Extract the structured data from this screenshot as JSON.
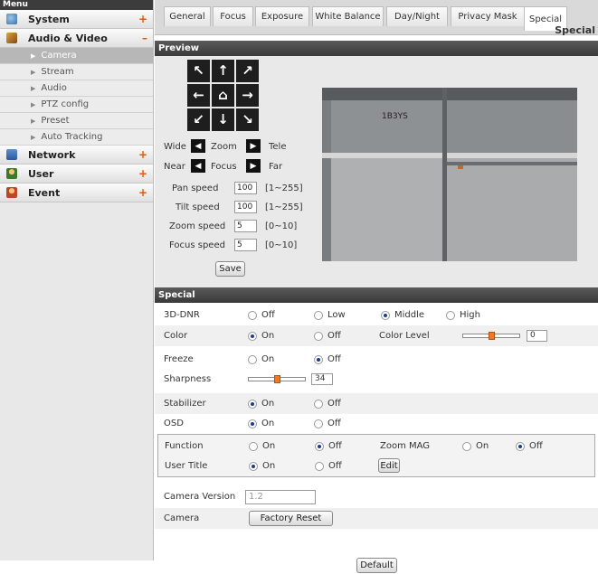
{
  "sidebar": {
    "menu_title": "Menu",
    "sections": [
      {
        "label": "System",
        "toggle": "+",
        "icon": "system-icon"
      },
      {
        "label": "Audio & Video",
        "toggle": "–",
        "icon": "audio-video-icon"
      },
      {
        "label": "Network",
        "toggle": "+",
        "icon": "network-icon"
      },
      {
        "label": "User",
        "toggle": "+",
        "icon": "user-icon"
      },
      {
        "label": "Event",
        "toggle": "+",
        "icon": "event-icon"
      }
    ],
    "sub_items": [
      {
        "label": "Camera",
        "active": true
      },
      {
        "label": "Stream"
      },
      {
        "label": "Audio"
      },
      {
        "label": "PTZ config"
      },
      {
        "label": "Preset"
      },
      {
        "label": "Auto Tracking"
      }
    ]
  },
  "tabs": [
    "General",
    "Focus",
    "Exposure",
    "White Balance",
    "Day/Night",
    "Privacy Mask",
    "Special"
  ],
  "active_tab": "Special",
  "page_subtitle": "Special",
  "preview": {
    "header": "Preview",
    "ptz_arrows": [
      "↖",
      "↑",
      "↗",
      "←",
      "⌂",
      "→",
      "↙",
      "↓",
      "↘"
    ],
    "zoom": {
      "left": "Wide",
      "center": "Zoom",
      "right": "Tele"
    },
    "focus": {
      "left": "Near",
      "center": "Focus",
      "right": "Far"
    },
    "speeds": [
      {
        "label": "Pan speed",
        "value": "100",
        "range": "[1~255]"
      },
      {
        "label": "Tilt speed",
        "value": "100",
        "range": "[1~255]"
      },
      {
        "label": "Zoom speed",
        "value": "5",
        "range": "[0~10]"
      },
      {
        "label": "Focus speed",
        "value": "5",
        "range": "[0~10]"
      }
    ],
    "save_label": "Save",
    "video_overlay_text": "1B3YS"
  },
  "special": {
    "header": "Special",
    "dnr": {
      "label": "3D-DNR",
      "options": [
        "Off",
        "Low",
        "Middle",
        "High"
      ],
      "selected": "Middle"
    },
    "color": {
      "label": "Color",
      "options": [
        "On",
        "Off"
      ],
      "selected": "On",
      "level_label": "Color Level",
      "level_value": "0",
      "level_slider": 0.5
    },
    "freeze": {
      "label": "Freeze",
      "options": [
        "On",
        "Off"
      ],
      "selected": "Off"
    },
    "sharpness": {
      "label": "Sharpness",
      "value": "34",
      "slider": 0.5
    },
    "stabilizer": {
      "label": "Stabilizer",
      "options": [
        "On",
        "Off"
      ],
      "selected": "On"
    },
    "osd": {
      "label": "OSD",
      "options": [
        "On",
        "Off"
      ],
      "selected": "On"
    },
    "function": {
      "label": "Function",
      "options": [
        "On",
        "Off"
      ],
      "selected": "Off",
      "zoom_mag_label": "Zoom MAG",
      "zoom_mag_options": [
        "On",
        "Off"
      ],
      "zoom_mag_selected": "Off"
    },
    "user_title": {
      "label": "User Title",
      "options": [
        "On",
        "Off"
      ],
      "selected": "On",
      "edit_label": "Edit"
    },
    "camera_version": {
      "label": "Camera Version",
      "value": "1.2"
    },
    "camera": {
      "label": "Camera",
      "reset_label": "Factory Reset"
    },
    "default_label": "Default"
  }
}
